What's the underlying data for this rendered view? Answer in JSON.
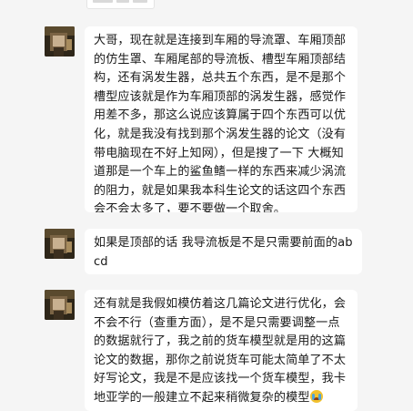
{
  "messages": [
    {
      "sender": "other",
      "text": "大哥，现在就是连接到车厢的导流罩、车厢顶部的仿生罩、车厢尾部的导流板、槽型车厢顶部结构，还有涡发生器，总共五个东西，是不是那个槽型应该就是作为车厢顶部的涡发生器，感觉作用差不多，那这么说应该算属于四个东西可以优化，就是我没有找到那个涡发生器的论文（没有带电脑现在不好上知网），但是搜了一下 大概知道那是一个车上的鲨鱼鳍一样的东西来减少涡流的阻力，就是如果我本科生论文的话这四个东西会不会太多了，要不要做一个取舍。"
    },
    {
      "sender": "other",
      "text": "如果是顶部的话 我导流板是不是只需要前面的abcd"
    },
    {
      "sender": "other",
      "text": "还有就是我假如模仿着这几篇论文进行优化，会不会不行（查重方面），是不是只需要调整一点的数据就行了，我之前的货车模型就是用的这篇论文的数据，那你之前说货车可能太简单了不太好写论文，我是不是应该找一个货车模型，我卡地亚学的一般建立不起来稍微复杂的模型",
      "trailing_emoji": "crying-face-emoji"
    }
  ],
  "colors": {
    "background": "#f5f5f5",
    "bubble": "#ffffff",
    "text": "#1a1a1a"
  }
}
